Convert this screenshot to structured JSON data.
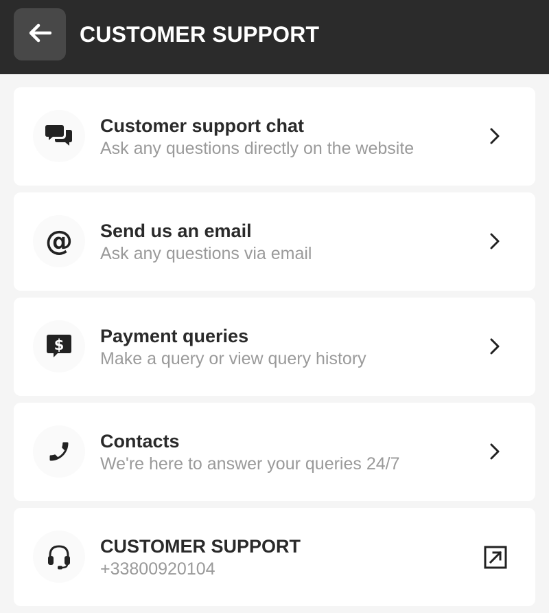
{
  "header": {
    "title": "CUSTOMER SUPPORT",
    "back_icon": "arrow-left-icon"
  },
  "items": [
    {
      "icon": "chat-bubbles-icon",
      "title": "Customer support chat",
      "subtitle": "Ask any questions directly on the website",
      "action_icon": "chevron-right-icon"
    },
    {
      "icon": "at-sign-icon",
      "title": "Send us an email",
      "subtitle": "Ask any questions via email",
      "action_icon": "chevron-right-icon"
    },
    {
      "icon": "dollar-message-icon",
      "title": "Payment queries",
      "subtitle": "Make a query or view query history",
      "action_icon": "chevron-right-icon"
    },
    {
      "icon": "phone-icon",
      "title": "Contacts",
      "subtitle": "We're here to answer your queries 24/7",
      "action_icon": "chevron-right-icon"
    },
    {
      "icon": "headset-icon",
      "title": "CUSTOMER SUPPORT",
      "subtitle": "+33800920104",
      "action_icon": "external-link-icon"
    }
  ],
  "colors": {
    "header_bg": "#2b2b2b",
    "back_button_bg": "#484848",
    "page_bg": "#f5f5f5",
    "card_bg": "#ffffff",
    "title_text": "#2a2a2a",
    "subtitle_text": "#9a9a9a"
  }
}
